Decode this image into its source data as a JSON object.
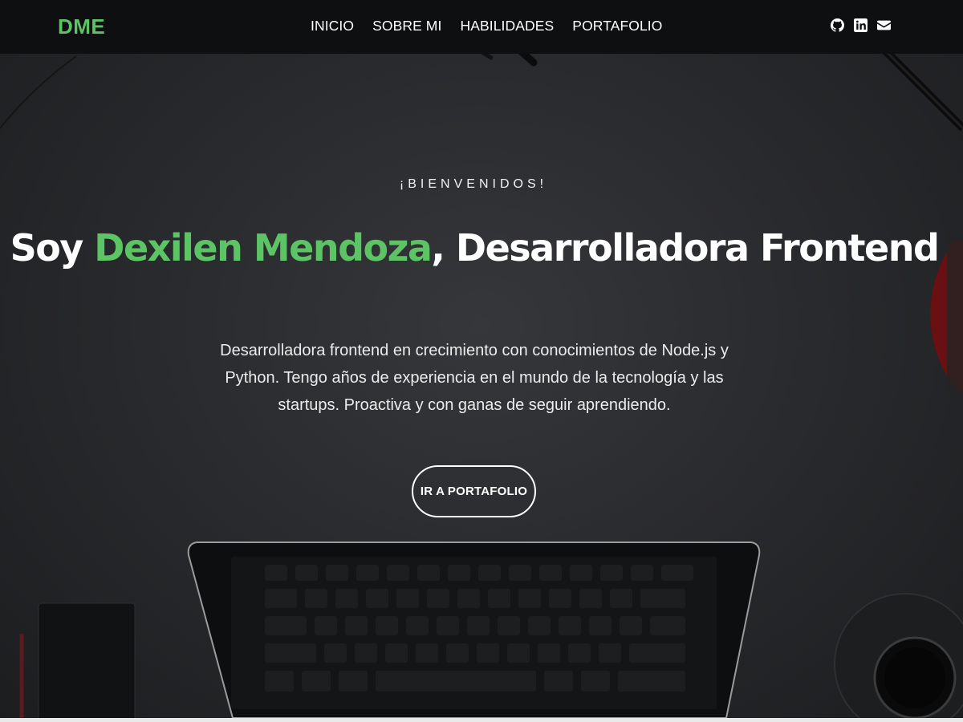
{
  "nav": {
    "brand": "DME",
    "links": [
      "INICIO",
      "SOBRE MI",
      "HABILIDADES",
      "PORTAFOLIO"
    ],
    "social_icons": [
      "github-icon",
      "linkedin-icon",
      "envelope-icon"
    ]
  },
  "hero": {
    "welcome": "¡BIENVENIDOS!",
    "headline_prefix": "Soy ",
    "headline_name": "Dexilen Mendoza",
    "headline_suffix": ", Desarrolladora Frontend",
    "description": "Desarrolladora frontend en crecimiento con conocimientos de Node.js y Python. Tengo años de experiencia en el mundo de la tecnología y las startups. Proactiva y con ganas de seguir aprendiendo.",
    "cta_label": "IR A PORTAFOLIO"
  },
  "colors": {
    "accent": "#5cc465",
    "navbar_bg": "#0e0f10",
    "hero_bg": "#2a2b2e",
    "text": "#ffffff"
  }
}
